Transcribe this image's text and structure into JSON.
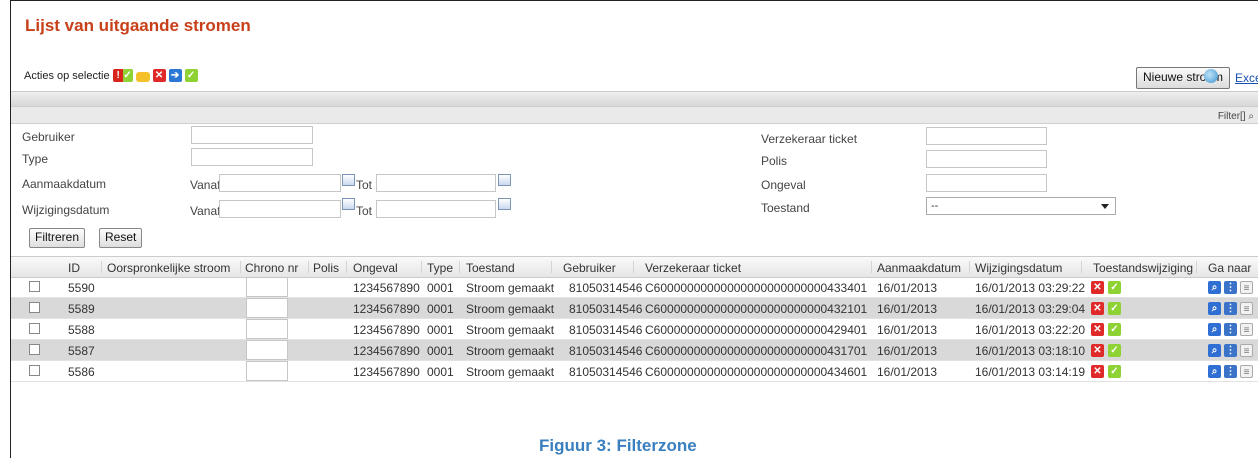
{
  "page": {
    "title": "Lijst van uitgaande stromen",
    "actions_label": "Acties op selectie",
    "action_icons": [
      "assign-warning-icon",
      "comment-icon",
      "reject-icon",
      "forward-icon",
      "approve-icon"
    ],
    "new_button": "Nieuwe stroom",
    "excel_link": "Excel Lijst",
    "filter_link": "Filter[]"
  },
  "filters": {
    "gebruiker_label": "Gebruiker",
    "gebruiker_value": "",
    "type_label": "Type",
    "type_value": "",
    "aanmaakdatum_label": "Aanmaakdatum",
    "wijzigingsdatum_label": "Wijzigingsdatum",
    "vanaf_label": "Vanaf",
    "tot_label": "Tot",
    "verzekeraar_label": "Verzekeraar ticket",
    "polis_label": "Polis",
    "ongeval_label": "Ongeval",
    "toestand_label": "Toestand",
    "toestand_selected": "--",
    "filter_button": "Filtreren",
    "reset_button": "Reset"
  },
  "table": {
    "columns": [
      "ID",
      "Oorspronkelijke stroom",
      "Chrono nr",
      "Polis",
      "Ongeval",
      "Type",
      "Toestand",
      "Gebruiker",
      "Verzekeraar ticket",
      "Aanmaakdatum",
      "Wijzigingsdatum",
      "Toestandswijziging",
      "Ga naar"
    ],
    "rows": [
      {
        "id": "5590",
        "ongeval": "1234567890",
        "type": "0001",
        "toestand": "Stroom gemaakt",
        "gebruiker": "81050314546",
        "ticket": "C60000000000000000000000000433401",
        "aanmaak": "16/01/2013",
        "wijziging": "16/01/2013 03:29:22"
      },
      {
        "id": "5589",
        "ongeval": "1234567890",
        "type": "0001",
        "toestand": "Stroom gemaakt",
        "gebruiker": "81050314546",
        "ticket": "C60000000000000000000000000432101",
        "aanmaak": "16/01/2013",
        "wijziging": "16/01/2013 03:29:04"
      },
      {
        "id": "5588",
        "ongeval": "1234567890",
        "type": "0001",
        "toestand": "Stroom gemaakt",
        "gebruiker": "81050314546",
        "ticket": "C60000000000000000000000000429401",
        "aanmaak": "16/01/2013",
        "wijziging": "16/01/2013 03:22:20"
      },
      {
        "id": "5587",
        "ongeval": "1234567890",
        "type": "0001",
        "toestand": "Stroom gemaakt",
        "gebruiker": "81050314546",
        "ticket": "C60000000000000000000000000431701",
        "aanmaak": "16/01/2013",
        "wijziging": "16/01/2013 03:18:10"
      },
      {
        "id": "5586",
        "ongeval": "1234567890",
        "type": "0001",
        "toestand": "Stroom gemaakt",
        "gebruiker": "81050314546",
        "ticket": "C60000000000000000000000000434601",
        "aanmaak": "16/01/2013",
        "wijziging": "16/01/2013 03:14:19"
      }
    ]
  },
  "caption": "Figuur 3: Filterzone",
  "colors": {
    "title": "#c8401a",
    "caption": "#3a7fc0",
    "link": "#1a4fb5",
    "reject": "#e02a2a",
    "approve": "#8fd233",
    "alt_row": "#d9d9d9"
  }
}
